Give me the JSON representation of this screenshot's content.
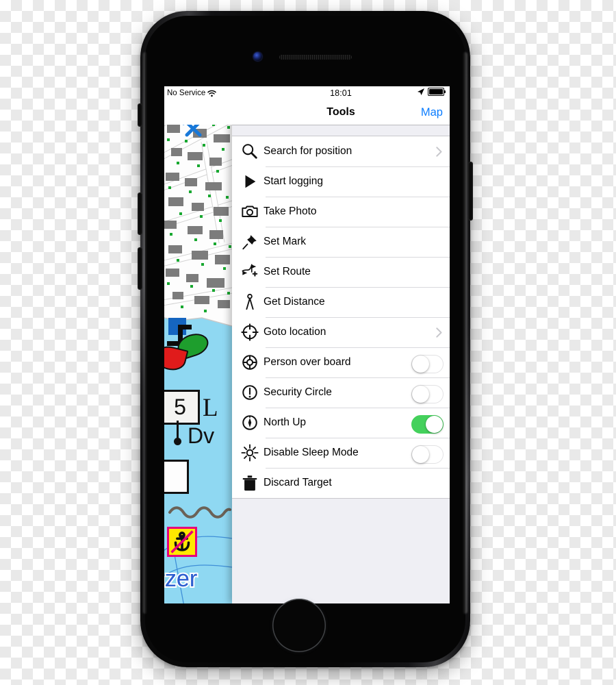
{
  "device": {
    "name": "iphone-7-jet-black",
    "camera_icon": "front-camera",
    "speaker_icon": "earpiece-speaker",
    "home_button_icon": "home-button"
  },
  "status_bar": {
    "carrier": "No Service",
    "wifi_icon": "wifi-icon",
    "time": "18:01",
    "location_icon": "location-arrow-icon",
    "battery_icon": "battery-full-icon"
  },
  "map": {
    "tools_badge_icon": "hammer-wrench-tools-icon",
    "depth_label": "5",
    "light_label": "L",
    "light_char_label": "Dv",
    "place_label_line1": "nzer",
    "place_label_line2": "er",
    "no_anchoring_icon": "no-anchoring-sign-icon",
    "green_buoy_icon": "green-buoy-icon",
    "red_buoy_icon": "red-buoy-icon",
    "cable_icon": "submarine-cable-icon",
    "colors": {
      "water": "#8fd8f2",
      "land": "#fdfdfd",
      "building": "#7c7c7c",
      "tree": "#18a830",
      "label_blue": "#2e5fd0",
      "buoy_green": "#1e9e2d",
      "buoy_red": "#e01b1b",
      "sign_yellow": "#ffe800",
      "sign_border": "#e8007a",
      "cable_pink": "#f0609a"
    }
  },
  "nav_bar": {
    "title": "Tools",
    "right_button": "Map",
    "accent_color": "#0a7cff"
  },
  "tools_list": [
    {
      "label": "Search for position",
      "icon": "magnifier-icon",
      "accessory": "chevron"
    },
    {
      "label": "Start logging",
      "icon": "play-triangle-icon",
      "accessory": "none"
    },
    {
      "label": "Take Photo",
      "icon": "camera-icon",
      "accessory": "none"
    },
    {
      "label": "Set Mark",
      "icon": "pushpin-icon",
      "accessory": "none"
    },
    {
      "label": "Set Route",
      "icon": "route-flags-plus-icon",
      "accessory": "none"
    },
    {
      "label": "Get Distance",
      "icon": "divider-caliper-icon",
      "accessory": "none"
    },
    {
      "label": "Goto location",
      "icon": "crosshair-icon",
      "accessory": "chevron"
    },
    {
      "label": "Person over board",
      "icon": "lifebuoy-icon",
      "accessory": "toggle",
      "toggle_on": false
    },
    {
      "label": "Security Circle",
      "icon": "exclamation-circle-icon",
      "accessory": "toggle",
      "toggle_on": false
    },
    {
      "label": "North Up",
      "icon": "compass-needle-icon",
      "accessory": "toggle",
      "toggle_on": true
    },
    {
      "label": "Disable Sleep Mode",
      "icon": "sun-brightness-icon",
      "accessory": "toggle",
      "toggle_on": false
    },
    {
      "label": "Discard Target",
      "icon": "trash-can-icon",
      "accessory": "none"
    }
  ],
  "theme": {
    "toggle_on_color": "#44d15c",
    "list_background": "#ffffff",
    "panel_background": "#efeff4",
    "separator": "#d9d9dd"
  }
}
